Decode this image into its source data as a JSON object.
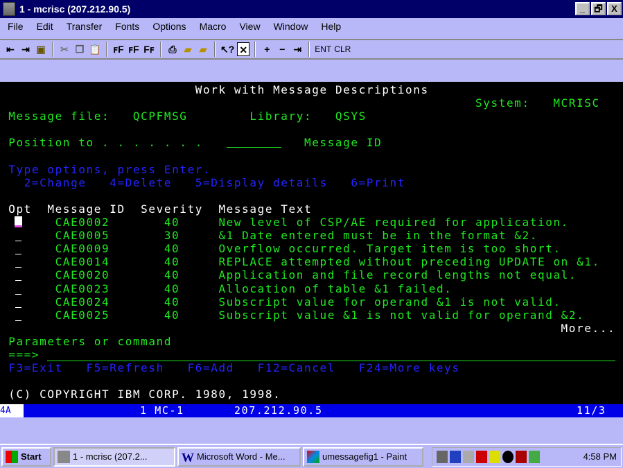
{
  "window": {
    "title": "1 - mcrisc (207.212.90.5)",
    "buttons": [
      "_",
      "🗗",
      "X"
    ]
  },
  "menu": [
    "File",
    "Edit",
    "Transfer",
    "Fonts",
    "Options",
    "Macro",
    "View",
    "Window",
    "Help"
  ],
  "toolbar": {
    "icons": [
      "send-file-icon",
      "receive-file-icon",
      "save-icon",
      "cut-icon",
      "copy-icon",
      "paste-icon",
      "font-auto-icon",
      "font-larger-icon",
      "font-smaller-icon",
      "print-icon",
      "open-folder-up-icon",
      "open-folder-down-icon",
      "help-pointer-icon",
      "close-box-icon",
      "plus-icon",
      "minus-icon",
      "tab-icon"
    ],
    "ent": "ENT",
    "clr": "CLR"
  },
  "screen": {
    "title": "Work with Message Descriptions",
    "system_label": "System:",
    "system_value": "MCRISC",
    "msgfile_label": "Message file:",
    "msgfile_value": "QCPFMSG",
    "library_label": "Library:",
    "library_value": "QSYS",
    "position_label": "Position to . . . . . . .",
    "position_value": "",
    "position_hint": "Message ID",
    "instructions": "Type options, press Enter.",
    "options": [
      "2=Change",
      "4=Delete",
      "5=Display details",
      "6=Print"
    ],
    "headers": {
      "opt": "Opt",
      "id": "Message ID",
      "severity": "Severity",
      "text": "Message Text"
    },
    "rows": [
      {
        "id": "CAE0002",
        "severity": "40",
        "text": "New level of CSP/AE required for application."
      },
      {
        "id": "CAE0005",
        "severity": "30",
        "text": "&1 Date entered must be in the format &2."
      },
      {
        "id": "CAE0009",
        "severity": "40",
        "text": "Overflow occurred. Target item is too short."
      },
      {
        "id": "CAE0014",
        "severity": "40",
        "text": "REPLACE attempted without preceding UPDATE on &1."
      },
      {
        "id": "CAE0020",
        "severity": "40",
        "text": "Application and file record lengths not equal."
      },
      {
        "id": "CAE0023",
        "severity": "40",
        "text": "Allocation of table &1 failed."
      },
      {
        "id": "CAE0024",
        "severity": "40",
        "text": "Subscript value for operand &1 is not valid."
      },
      {
        "id": "CAE0025",
        "severity": "40",
        "text": "Subscript value &1 is not valid for operand &2."
      }
    ],
    "more": "More...",
    "params_label": "Parameters or command",
    "prompt": "===>",
    "fkeys": [
      "F3=Exit",
      "F5=Refresh",
      "F6=Add",
      "F12=Cancel",
      "F24=More keys"
    ],
    "copyright": "(C) COPYRIGHT IBM CORP. 1980, 1998."
  },
  "status": {
    "oia": "4A",
    "session": "1 MC-1",
    "host": "207.212.90.5",
    "cursor": "11/3"
  },
  "taskbar": {
    "start": "Start",
    "tasks": [
      "1 - mcrisc (207.2...",
      "Microsoft Word - Me...",
      "umessagefig1 - Paint"
    ],
    "clock": "4:58 PM"
  }
}
